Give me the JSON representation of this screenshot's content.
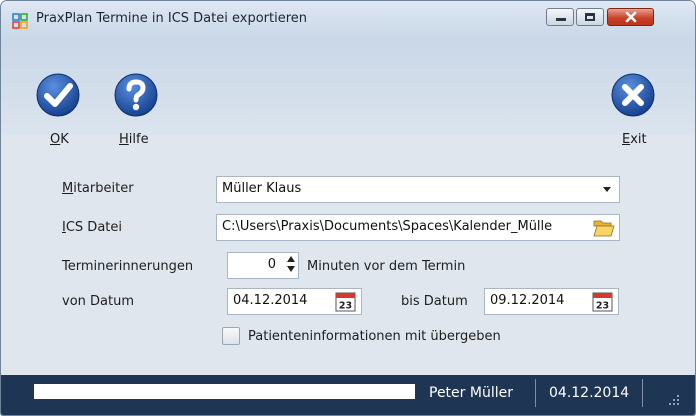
{
  "window": {
    "title": "PraxPlan Termine in ICS Datei exportieren"
  },
  "toolbar": {
    "ok": {
      "label_mnemonic": "O",
      "label_rest": "K",
      "icon": "checkmark-icon"
    },
    "help": {
      "label_mnemonic": "H",
      "label_rest": "ilfe",
      "icon": "question-icon"
    },
    "exit": {
      "label_mnemonic": "E",
      "label_rest": "xit",
      "icon": "close-circle-icon"
    }
  },
  "form": {
    "mitarbeiter": {
      "label_mnemonic": "M",
      "label_rest": "itarbeiter",
      "value": "Müller Klaus"
    },
    "ics": {
      "label_mnemonic": "I",
      "label_rest": "CS Datei",
      "value": "C:\\Users\\Praxis\\Documents\\Spaces\\Kalender_Mülle"
    },
    "reminder": {
      "label": "Terminerinnerungen",
      "value": "0",
      "suffix": "Minuten vor dem Termin"
    },
    "from_date": {
      "label": "von Datum",
      "value": "04.12.2014"
    },
    "to_date": {
      "label": "bis Datum",
      "value": "09.12.2014"
    },
    "calendar_day": "23",
    "patient_info": {
      "label": "Patienteninformationen mit übergeben",
      "checked": false
    }
  },
  "status": {
    "user": "Peter Müller",
    "date": "04.12.2014"
  },
  "colors": {
    "accent_blue": "#1f4f9e",
    "status_bg": "#1f3554",
    "close_red": "#c9432a"
  }
}
